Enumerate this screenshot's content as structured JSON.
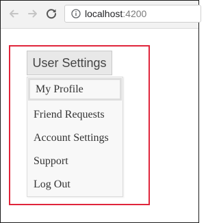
{
  "browser": {
    "url_host": "localhost",
    "url_port": ":4200",
    "back_icon": "arrow-left-icon",
    "forward_icon": "arrow-right-icon",
    "reload_icon": "reload-icon",
    "info_icon": "info-icon"
  },
  "dropdown": {
    "toggle_label": "User Settings",
    "items": [
      {
        "label": "My Profile",
        "active": true
      },
      {
        "label": "Friend Requests"
      },
      {
        "label": "Account Settings"
      },
      {
        "label": "Support"
      },
      {
        "label": "Log Out"
      }
    ]
  },
  "colors": {
    "highlight": "#e0243a",
    "toggle_bg": "#e8e8e8",
    "menu_bg": "#f8f8f8"
  }
}
